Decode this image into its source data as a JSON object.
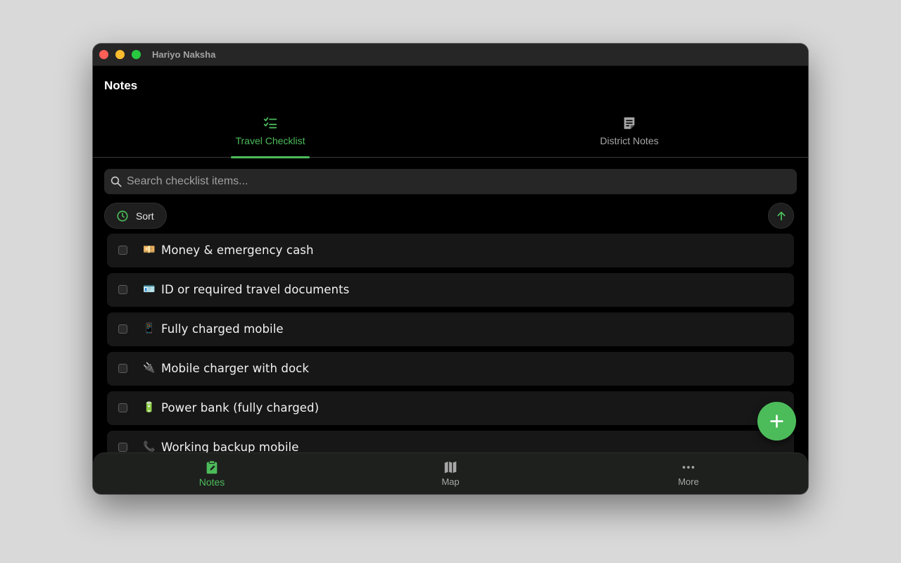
{
  "window": {
    "title": "Hariyo Naksha"
  },
  "header": {
    "title": "Notes"
  },
  "tabs": [
    {
      "label": "Travel Checklist",
      "icon": "checklist-icon",
      "active": true
    },
    {
      "label": "District Notes",
      "icon": "note-icon",
      "active": false
    }
  ],
  "search": {
    "placeholder": "Search checklist items...",
    "value": ""
  },
  "toolbar": {
    "sort_label": "Sort"
  },
  "checklist": {
    "items": [
      {
        "emoji": "💴",
        "text": "Money & emergency cash",
        "checked": false
      },
      {
        "emoji": "🪪",
        "text": "ID or required travel documents",
        "checked": false
      },
      {
        "emoji": "📱",
        "text": "Fully charged mobile",
        "checked": false
      },
      {
        "emoji": "🔌",
        "text": "Mobile charger with dock",
        "checked": false
      },
      {
        "emoji": "🔋",
        "text": "Power bank (fully charged)",
        "checked": false
      },
      {
        "emoji": "📞",
        "text": "Working backup mobile",
        "checked": false
      }
    ]
  },
  "bottom_nav": [
    {
      "label": "Notes",
      "icon": "clipboard-icon",
      "active": true
    },
    {
      "label": "Map",
      "icon": "map-icon",
      "active": false
    },
    {
      "label": "More",
      "icon": "more-icon",
      "active": false
    }
  ],
  "colors": {
    "accent": "#4cbb5a",
    "background": "#000000",
    "surface": "#171717"
  }
}
